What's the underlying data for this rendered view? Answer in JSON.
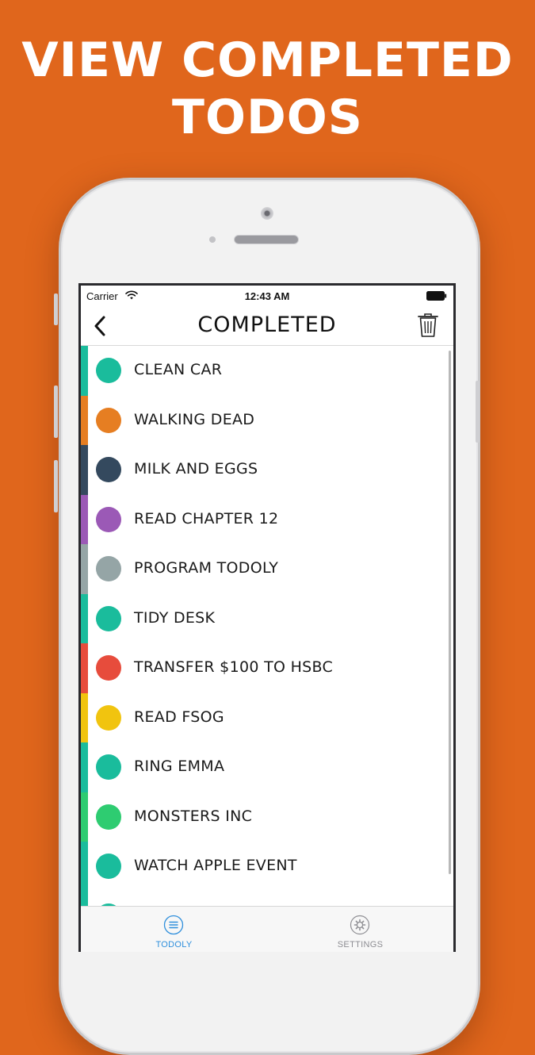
{
  "headline": {
    "line1": "VIEW COMPLETED",
    "line2": "TODOS"
  },
  "status_bar": {
    "carrier": "Carrier",
    "time": "12:43 AM"
  },
  "nav": {
    "title": "COMPLETED",
    "back_icon": "chevron-left-icon",
    "trash_icon": "trash-icon"
  },
  "todos": [
    {
      "label": "CLEAN CAR",
      "color": "#1abc9c"
    },
    {
      "label": "WALKING DEAD",
      "color": "#e67e22"
    },
    {
      "label": "MILK AND EGGS",
      "color": "#34495e"
    },
    {
      "label": "READ CHAPTER 12",
      "color": "#9b59b6"
    },
    {
      "label": "PROGRAM TODOLY",
      "color": "#95a5a6"
    },
    {
      "label": "TIDY DESK",
      "color": "#1abc9c"
    },
    {
      "label": "TRANSFER $100 TO HSBC",
      "color": "#e74c3c"
    },
    {
      "label": "READ FSOG",
      "color": "#f1c40f"
    },
    {
      "label": "RING EMMA",
      "color": "#1abc9c"
    },
    {
      "label": "MONSTERS INC",
      "color": "#2ecc71"
    },
    {
      "label": "WATCH APPLE EVENT",
      "color": "#1abc9c"
    },
    {
      "label": "",
      "color": "#1abc9c"
    }
  ],
  "tabs": [
    {
      "label": "TODOLY",
      "icon": "list-icon",
      "active": true,
      "color": "#2f8fdc"
    },
    {
      "label": "SETTINGS",
      "icon": "gear-icon",
      "active": false,
      "color": "#8e8e93"
    }
  ],
  "colors": {
    "background": "#e0661c",
    "accent": "#2f8fdc"
  }
}
